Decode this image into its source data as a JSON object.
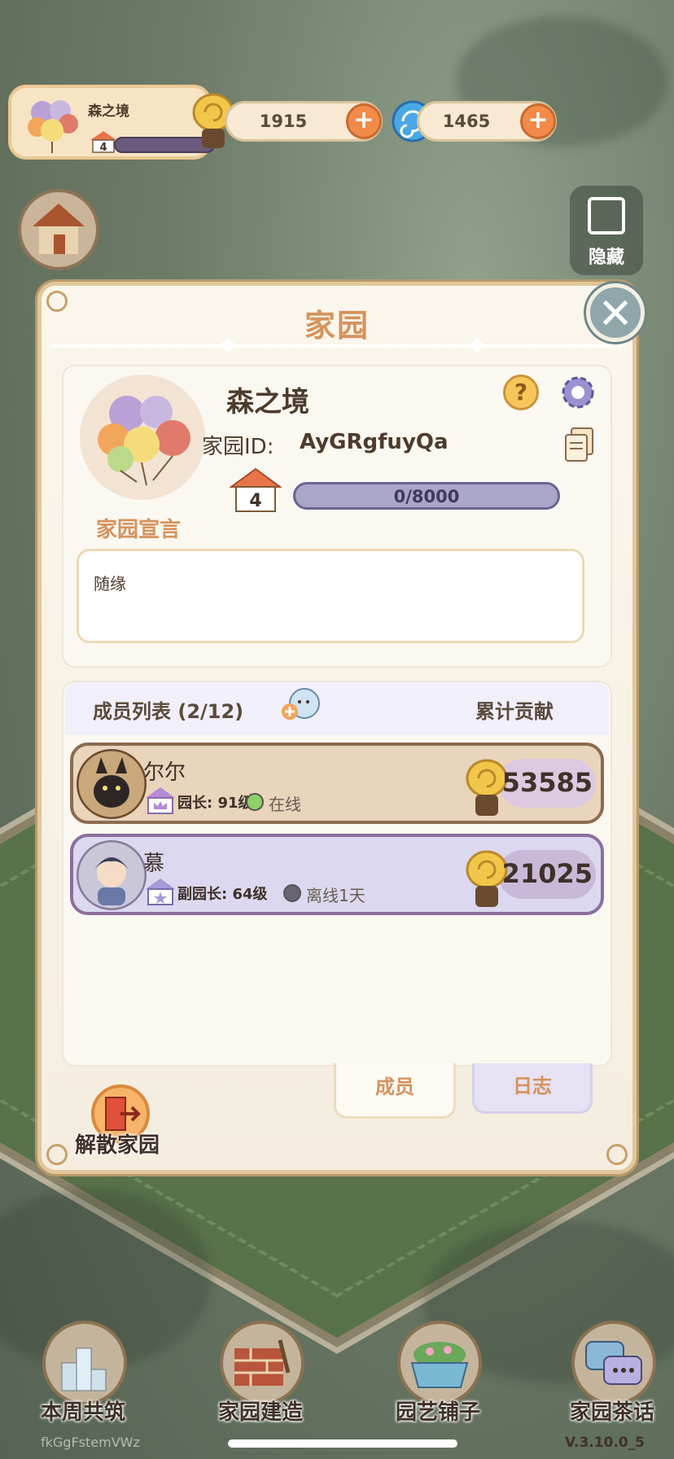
{
  "hud": {
    "garden_name": "森之境",
    "level": "4",
    "snail_coins": "1915",
    "spiral_gems": "1465",
    "plus": "+",
    "hide_label": "隐藏"
  },
  "panel": {
    "title": "家园",
    "close": "✕",
    "garden_name": "森之境",
    "id_label": "家园ID:",
    "id_value": "AyGRgfuyQa",
    "help": "?",
    "level": "4",
    "exp": "0/8000",
    "declaration_label": "家园宣言",
    "declaration_text": "随缘"
  },
  "members": {
    "title": "成员列表 (2/12)",
    "contribution_header": "累计贡献",
    "rows": [
      {
        "name": "尔尔",
        "role": "园长: 91级",
        "status": "在线",
        "status_color": "#8fd06a",
        "contribution": "53585"
      },
      {
        "name": "慕",
        "role": "副园长: 64级",
        "status": "离线1天",
        "status_color": "#6a6470",
        "contribution": "21025"
      }
    ]
  },
  "tabs": {
    "members": "成员",
    "log": "日志"
  },
  "disband_label": "解散家园",
  "nav": {
    "items": [
      "本周共筑",
      "家园建造",
      "园艺铺子",
      "家园茶话"
    ]
  },
  "footer": {
    "left": "fkGgFstemVWz",
    "version": "V.3.10.0_5"
  },
  "colors": {
    "accent_orange": "#d6925b",
    "panel_border": "#e1c79a",
    "online": "#8fd06a",
    "offline": "#6a6470"
  }
}
